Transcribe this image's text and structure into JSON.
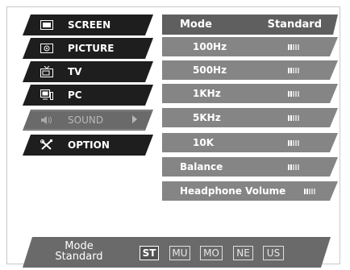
{
  "menu": {
    "items": [
      {
        "label": "SCREEN",
        "icon": "screen-icon",
        "selected": false
      },
      {
        "label": "PICTURE",
        "icon": "picture-icon",
        "selected": false
      },
      {
        "label": "TV",
        "icon": "tv-icon",
        "selected": false
      },
      {
        "label": "PC",
        "icon": "pc-icon",
        "selected": false
      },
      {
        "label": "SOUND",
        "icon": "speaker-icon",
        "selected": true
      },
      {
        "label": "OPTION",
        "icon": "tools-icon",
        "selected": false
      }
    ]
  },
  "sound": {
    "mode_label": "Mode",
    "mode_value": "Standard",
    "rows": [
      {
        "label": "100Hz",
        "level": 0.5
      },
      {
        "label": "500Hz",
        "level": 0.5
      },
      {
        "label": "1KHz",
        "level": 0.5
      },
      {
        "label": "5KHz",
        "level": 0.5
      },
      {
        "label": "10K",
        "level": 0.5
      },
      {
        "label": "Balance",
        "level": 0.5
      },
      {
        "label": "Headphone Volume",
        "level": 0.5
      }
    ]
  },
  "bottom": {
    "mode_label": "Mode",
    "mode_value": "Standard",
    "buttons": [
      "ST",
      "MU",
      "MO",
      "NE",
      "US"
    ],
    "active_index": 0
  }
}
